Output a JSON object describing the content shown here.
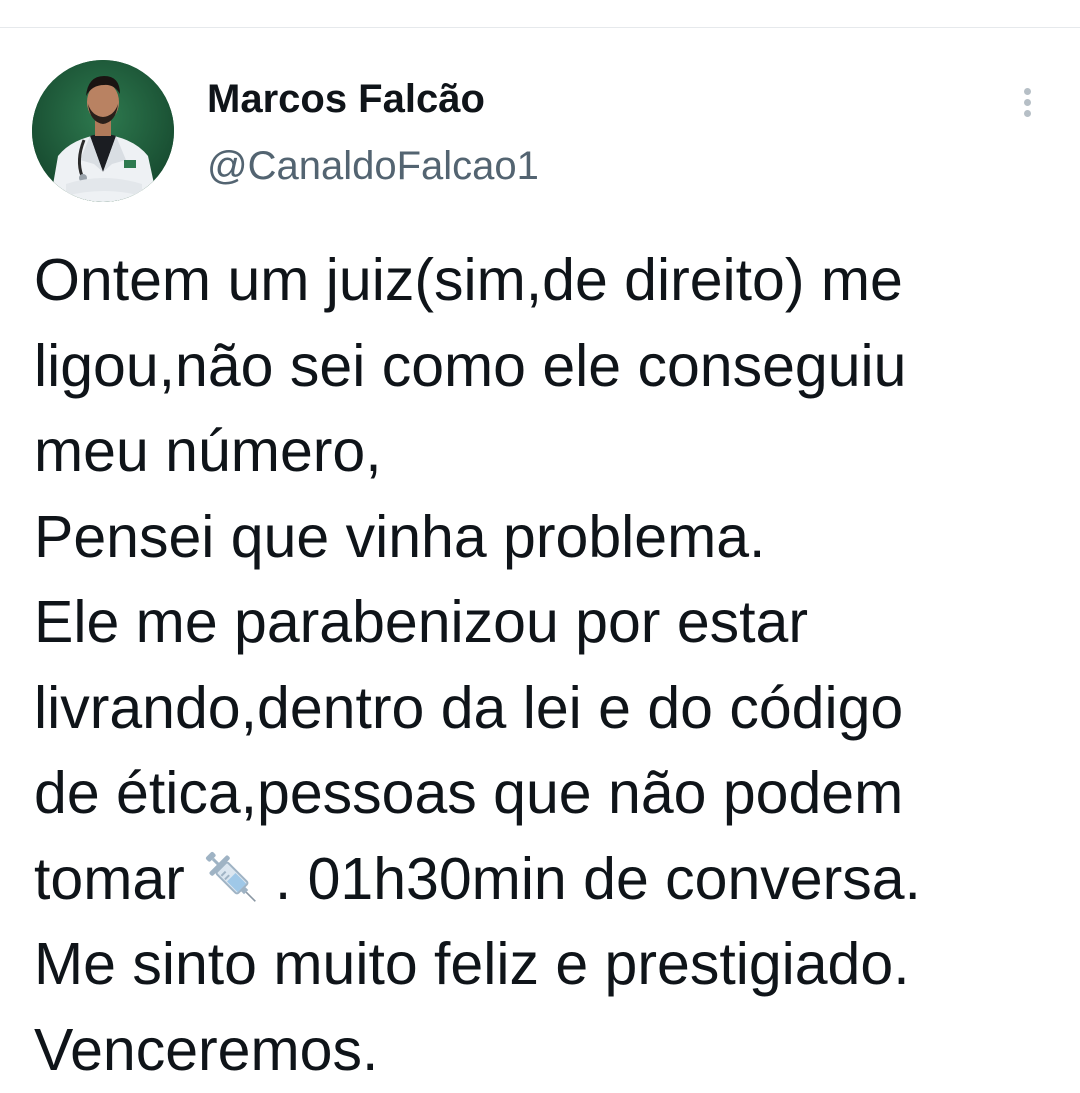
{
  "tweet": {
    "author": {
      "display_name": "Marcos Falcão",
      "handle": "@CanaldoFalcao1",
      "avatar_icon": "avatar-photo-doctor-in-white-coat"
    },
    "more_icon": "more-vertical-icon",
    "text": {
      "line_1": "Ontem um juiz(sim,de direito) me",
      "line_2": "ligou,não sei como ele conseguiu",
      "line_3": "meu número,",
      "line_4": "Pensei que vinha problema.",
      "line_5": "Ele me parabenizou por estar",
      "line_6": "livrando,dentro da lei e do código",
      "line_7": "de ética,pessoas que não podem",
      "line_8_before_emoji": "tomar",
      "line_8_emoji": "syringe-icon",
      "line_8_after_emoji": ". 01h30min de conversa.",
      "line_9": "Me sinto muito feliz e prestigiado.",
      "line_10": "Venceremos."
    }
  },
  "colors": {
    "text_primary": "#0f1419",
    "text_secondary": "#536471",
    "avatar_background": "#1f5a3a",
    "more_dots": "#b6bfc6",
    "divider": "#e6e9ec"
  }
}
